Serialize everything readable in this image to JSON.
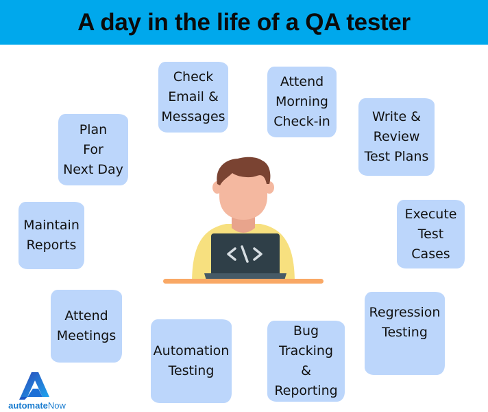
{
  "header": {
    "title": "A day in the life of a QA tester",
    "background": "#00a8ec"
  },
  "cards": [
    {
      "id": "check-email",
      "label": "Check\nEmail &\nMessages"
    },
    {
      "id": "morning-checkin",
      "label": "Attend\nMorning\nCheck-in"
    },
    {
      "id": "write-test-plans",
      "label": "Write &\nReview\nTest Plans"
    },
    {
      "id": "execute-test-cases",
      "label": "Execute\nTest\nCases"
    },
    {
      "id": "regression-testing",
      "label": "Regression\nTesting"
    },
    {
      "id": "bug-tracking",
      "label": "Bug\nTracking\n& Reporting"
    },
    {
      "id": "automation-testing",
      "label": "Automation\nTesting"
    },
    {
      "id": "attend-meetings",
      "label": "Attend\nMeetings"
    },
    {
      "id": "maintain-reports",
      "label": "Maintain\nReports"
    },
    {
      "id": "plan-next-day",
      "label": "Plan\nFor\nNext Day"
    }
  ],
  "card_color": "#bcd6fb",
  "illustration": {
    "subject": "person-at-laptop",
    "laptop_glyph": "</>",
    "colors": {
      "hair": "#7a4332",
      "skin": "#f4b8a0",
      "neck": "#e8a48c",
      "shirt": "#f7e07f",
      "laptop": "#2f3f48",
      "laptop_base": "#465a66",
      "desk": "#f9a865"
    }
  },
  "logo": {
    "brand_bold": "automate",
    "brand_light": "Now"
  }
}
